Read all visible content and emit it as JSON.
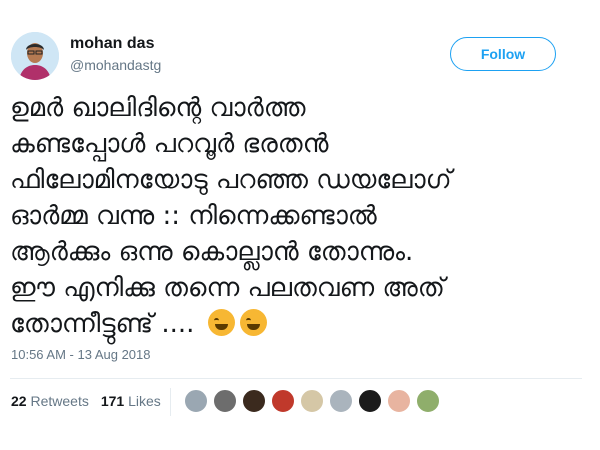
{
  "author": {
    "name": "mohan das",
    "handle": "@mohandastg"
  },
  "follow_label": "Follow",
  "tweet": {
    "text": "ഉമർ ഖാലിദിന്റെ വാർത്ത\nകണ്ടപ്പോൾ പറവൂർ ഭരതൻ\nഫിലോമിനയോടു പറഞ്ഞ ഡയലോഗ്\nഓർമ്മ വന്നു :: നിന്നെക്കണ്ടാൽ\nആർക്കും ഒന്നു കൊല്ലാൻ തോന്നും.\nഈ എനിക്കു തന്നെ പലതവണ അത്\nതോന്നീട്ടുണ്ട് ....",
    "emoji_count": 2,
    "emoji_icon": "rolling-on-floor-laughing-emoji"
  },
  "timestamp": "10:56 AM - 13 Aug 2018",
  "stats": {
    "retweets_count": "22",
    "retweets_label": "Retweets",
    "likes_count": "171",
    "likes_label": "Likes"
  },
  "liker_avatars": [
    {
      "color": "#9aa7b2"
    },
    {
      "color": "#6d6d6d"
    },
    {
      "color": "#3b2a1e"
    },
    {
      "color": "#c0392b"
    },
    {
      "color": "#d5c7a6"
    },
    {
      "color": "#aab4bd"
    },
    {
      "color": "#1b1b1b"
    },
    {
      "color": "#e8b4a0"
    },
    {
      "color": "#8fae6b"
    }
  ],
  "colors": {
    "accent": "#1da1f2",
    "muted": "#657786",
    "text": "#14171a"
  }
}
